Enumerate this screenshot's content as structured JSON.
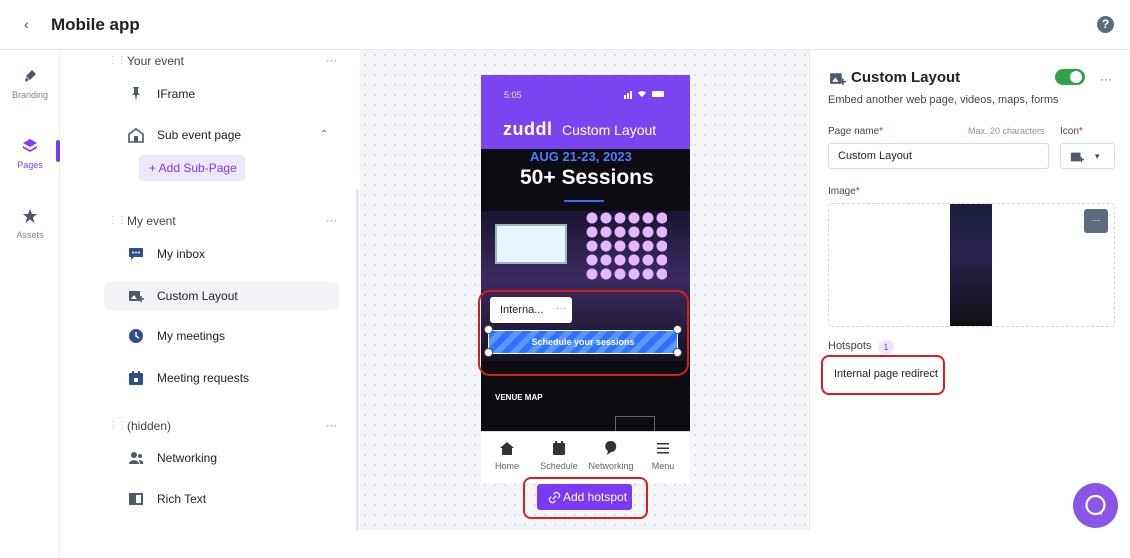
{
  "header": {
    "back_glyph": "‹",
    "title": "Mobile app",
    "help_glyph": "?"
  },
  "rail": {
    "items": [
      {
        "label": "Branding",
        "icon": "brush-icon"
      },
      {
        "label": "Pages",
        "icon": "layers-icon",
        "active": true
      },
      {
        "label": "Assets",
        "icon": "star-icon"
      }
    ]
  },
  "pages_panel": {
    "groups": [
      {
        "title": "Your event",
        "more": "···"
      },
      {
        "title": "My event",
        "more": "···"
      },
      {
        "title": "(hidden)",
        "more": "···"
      }
    ],
    "items": [
      {
        "label": "IFrame",
        "icon": "pin-icon"
      },
      {
        "label": "Sub event page",
        "icon": "sub-event-icon"
      },
      {
        "label": "My inbox",
        "icon": "chat-icon"
      },
      {
        "label": "Custom Layout",
        "icon": "custom-layout-icon",
        "selected": true
      },
      {
        "label": "My meetings",
        "icon": "clock-icon"
      },
      {
        "label": "Meeting requests",
        "icon": "calendar-icon"
      },
      {
        "label": "Networking",
        "icon": "people-icon"
      },
      {
        "label": "Rich Text",
        "icon": "book-icon"
      }
    ],
    "add_sub_page": "+ Add Sub-Page"
  },
  "phone": {
    "time": "5:05",
    "brand": "zuddl",
    "screen_title": "Custom Layout",
    "event_date": "AUG 21-23, 2023",
    "event_sessions": "50+ Sessions",
    "hotspot_label": "Interna...",
    "hotspot_more": "···",
    "hotspot_text": "Schedule your sessions",
    "venue_label": "VENUE MAP",
    "nav": [
      {
        "label": "Home",
        "icon": "home-icon"
      },
      {
        "label": "Schedule",
        "icon": "calendar-icon"
      },
      {
        "label": "Networking",
        "icon": "chat-icon"
      },
      {
        "label": "Menu",
        "icon": "menu-icon"
      }
    ]
  },
  "add_hotspot": "Add hotspot",
  "properties": {
    "title": "Custom Layout",
    "more": "···",
    "subtitle": "Embed another web page, videos, maps, forms",
    "page_name_label": "Page name",
    "page_name_hint": "Max. 20 characters",
    "page_name_value": "Custom Layout",
    "icon_label": "Icon",
    "image_label": "Image",
    "hotspots_label": "Hotspots",
    "hotspots_count": "1",
    "hotspot_entry": "Internal page redirect",
    "required_mark": "*",
    "toggle_on": true
  },
  "colors": {
    "accent": "#7b3ff2",
    "toggle": "#2fa14b",
    "highlight": "#d81f1f"
  }
}
